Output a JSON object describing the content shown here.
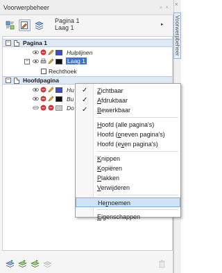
{
  "docker": {
    "title": "Voorwerpbeheer",
    "controls": "»  ×",
    "side_tab_label": "Voorwerpbeheer",
    "side_tab_close": "×"
  },
  "toolbar": {
    "page_line1": "Pagina 1",
    "page_line2": "Laag 1",
    "arrow": "▸"
  },
  "tree": {
    "page1": {
      "expander": "−",
      "label": "Pagina 1"
    },
    "guides": {
      "label": "Hulplijnen",
      "color": "#3a4fd0"
    },
    "layer1": {
      "expander": "−",
      "label": "Laag 1",
      "color": "#111111"
    },
    "rect": {
      "expander": "",
      "label": "Rechthoek"
    },
    "master": {
      "expander": "−",
      "label": "Hoofdpagina"
    },
    "m_guides": {
      "label": "Hu",
      "color": "#3a4fd0"
    },
    "m_desktop": {
      "label": "Bu",
      "color": "#111111"
    },
    "m_doc": {
      "label": "Do",
      "color": "#c8c8c8"
    }
  },
  "context_menu": {
    "items": [
      {
        "pre": "",
        "acc": "Z",
        "post": "ichtbaar",
        "checked": true
      },
      {
        "pre": "",
        "acc": "A",
        "post": "fdrukbaar",
        "checked": true
      },
      {
        "pre": "",
        "acc": "B",
        "post": "ewerkbaar",
        "checked": true
      },
      {
        "pre": "",
        "acc": "H",
        "post": "oofd (alle pagina's)",
        "checked": false
      },
      {
        "pre": "Hoofd (",
        "acc": "o",
        "post": "neven pagina's)",
        "checked": false
      },
      {
        "pre": "Hoofd (e",
        "acc": "v",
        "post": "en pagina's)",
        "checked": false
      },
      {
        "pre": "",
        "acc": "K",
        "post": "nippen",
        "checked": false
      },
      {
        "pre": "",
        "acc": "K",
        "post": "opiëren",
        "checked": false
      },
      {
        "pre": "",
        "acc": "P",
        "post": "lakken",
        "checked": false
      },
      {
        "pre": "",
        "acc": "V",
        "post": "erwijderen",
        "checked": false
      },
      {
        "pre": "He",
        "acc": "r",
        "post": "noemen",
        "checked": false
      },
      {
        "pre": "",
        "acc": "E",
        "post": "igenschappen",
        "checked": false
      }
    ],
    "check_glyph": "✓",
    "hovered_index": 10
  }
}
